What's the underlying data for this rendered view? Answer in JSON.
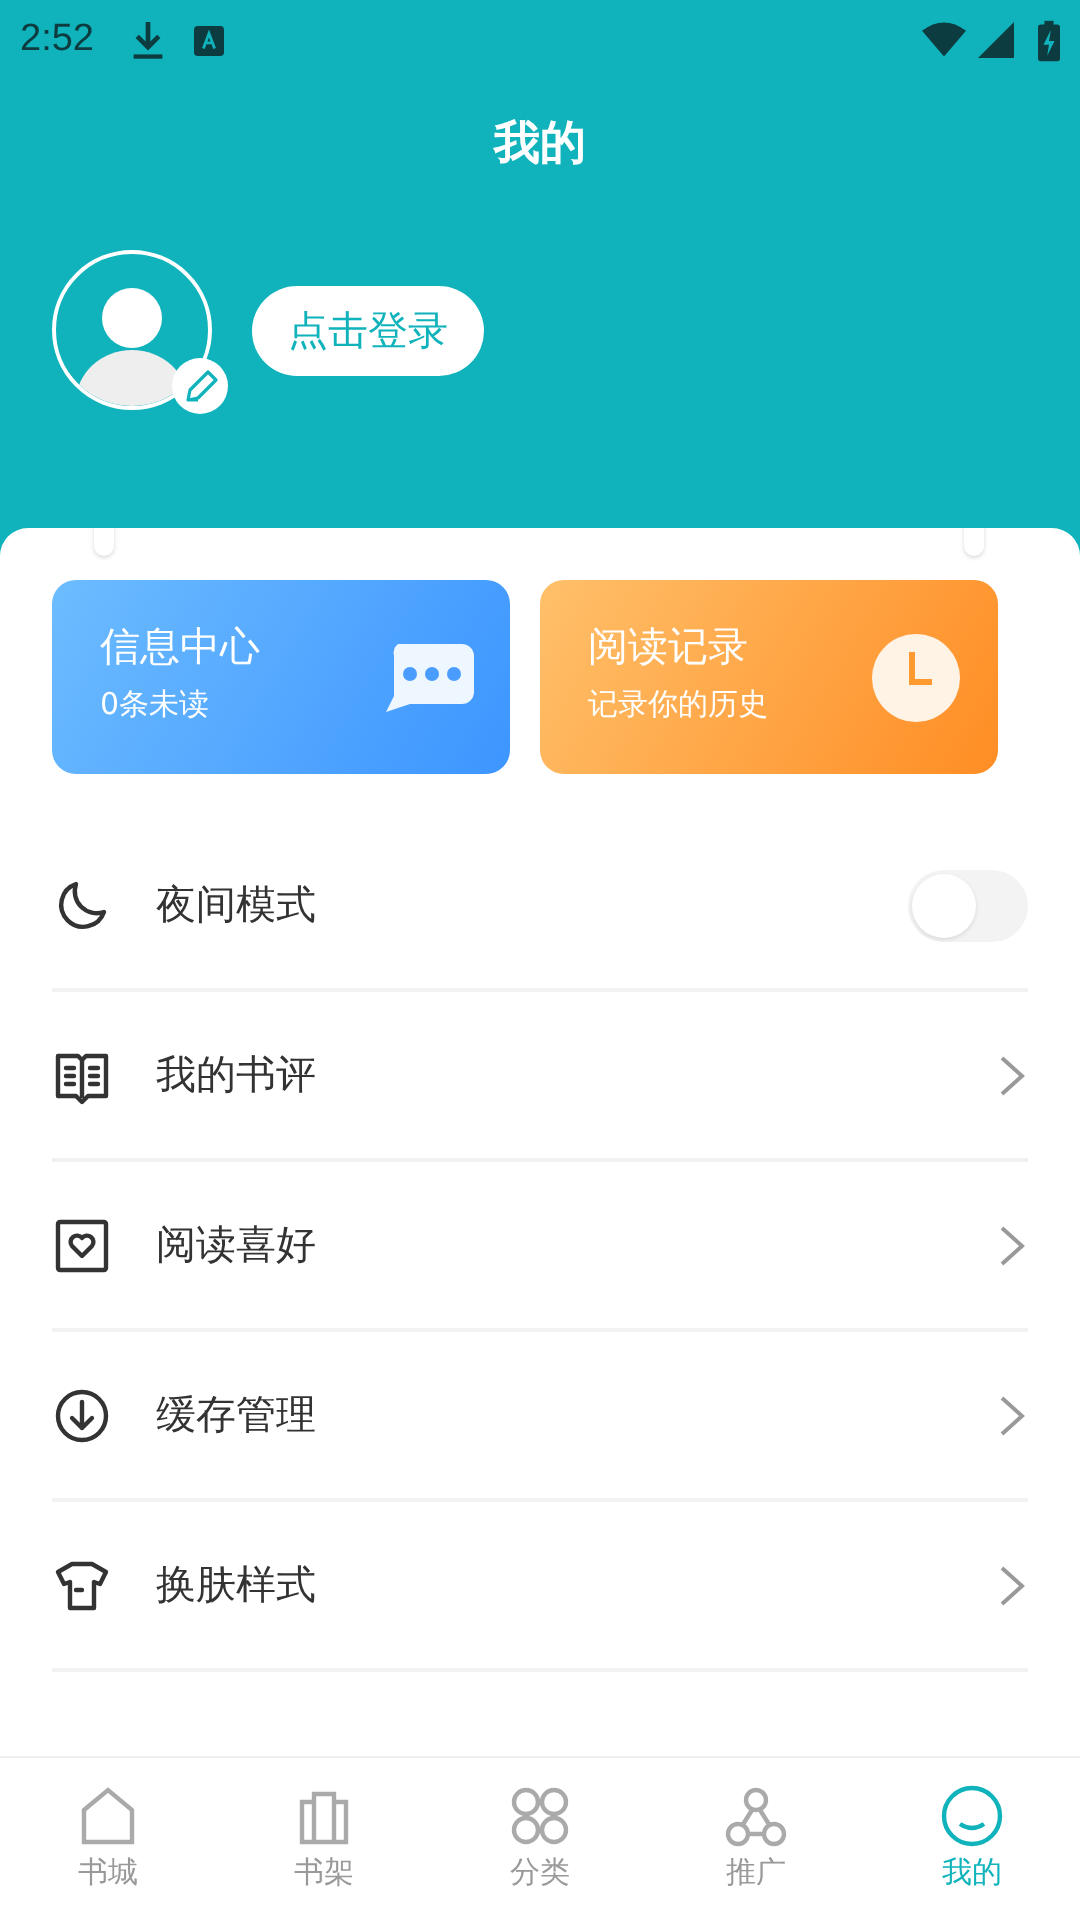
{
  "status_bar": {
    "time": "2:52"
  },
  "header": {
    "title": "我的",
    "login_button": "点击登录"
  },
  "cards": [
    {
      "kind": "messages",
      "title": "信息中心",
      "subtitle": "0条未读"
    },
    {
      "kind": "history",
      "title": "阅读记录",
      "subtitle": "记录你的历史"
    }
  ],
  "menu": [
    {
      "kind": "toggle",
      "label": "夜间模式",
      "on": false
    },
    {
      "kind": "link",
      "label": "我的书评"
    },
    {
      "kind": "link",
      "label": "阅读喜好"
    },
    {
      "kind": "link",
      "label": "缓存管理"
    },
    {
      "kind": "link",
      "label": "换肤样式"
    }
  ],
  "tab_bar": [
    {
      "label": "书城",
      "selected": false
    },
    {
      "label": "书架",
      "selected": false
    },
    {
      "label": "分类",
      "selected": false
    },
    {
      "label": "推广",
      "selected": false
    },
    {
      "label": "我的",
      "selected": true
    }
  ]
}
